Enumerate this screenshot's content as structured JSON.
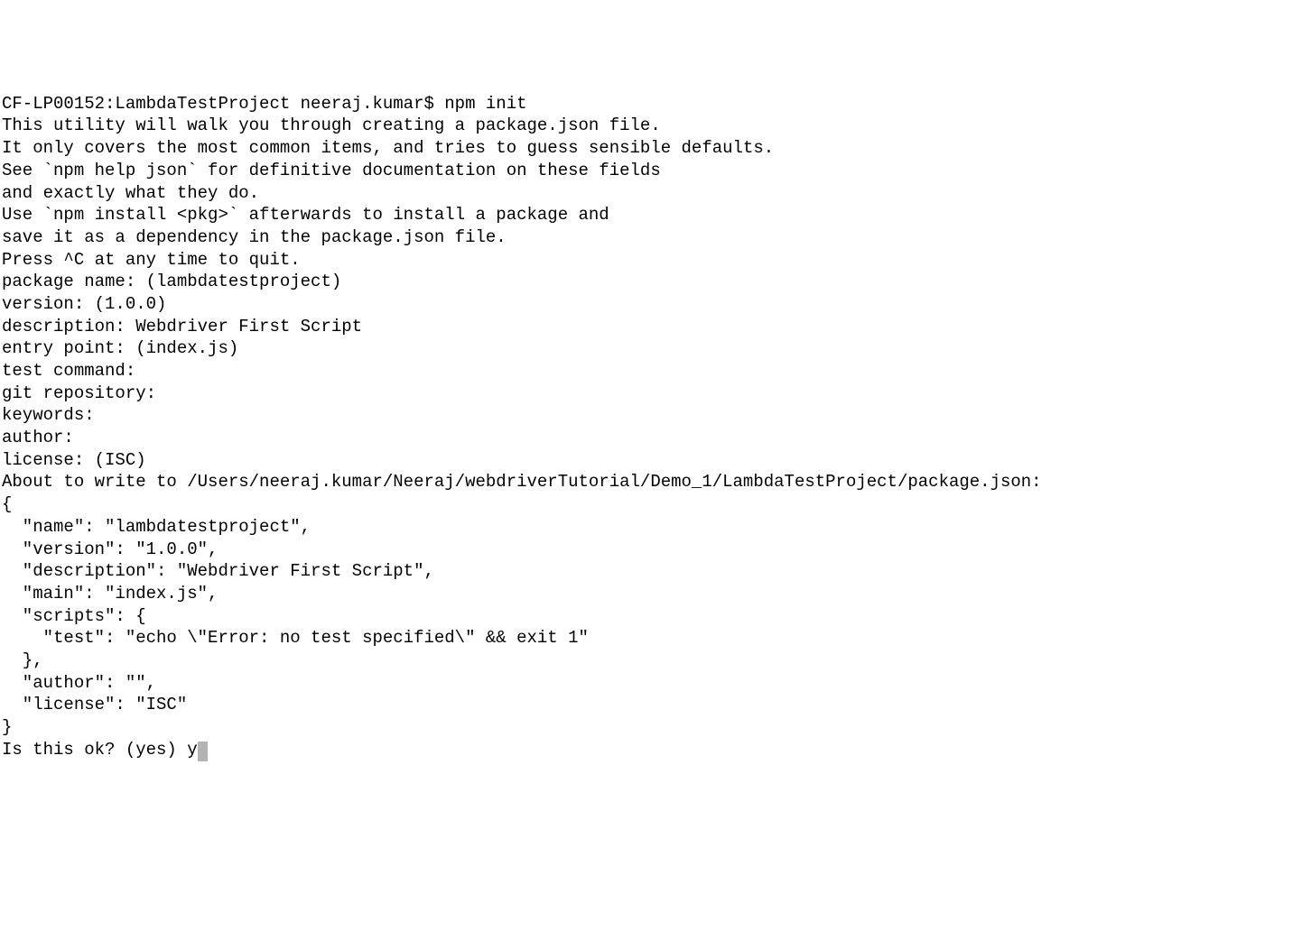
{
  "terminal": {
    "prompt_line": "CF-LP00152:LambdaTestProject neeraj.kumar$ npm init",
    "intro_1": "This utility will walk you through creating a package.json file.",
    "intro_2": "It only covers the most common items, and tries to guess sensible defaults.",
    "blank_1": "",
    "see_1": "See `npm help json` for definitive documentation on these fields",
    "see_2": "and exactly what they do.",
    "blank_2": "",
    "use_1": "Use `npm install <pkg>` afterwards to install a package and",
    "use_2": "save it as a dependency in the package.json file.",
    "blank_3": "",
    "press": "Press ^C at any time to quit.",
    "pkg_name": "package name: (lambdatestproject) ",
    "version": "version: (1.0.0) ",
    "description": "description: Webdriver First Script",
    "entry": "entry point: (index.js) ",
    "test_cmd": "test command: ",
    "git_repo": "git repository: ",
    "keywords": "keywords: ",
    "author": "author: ",
    "license": "license: (ISC) ",
    "about": "About to write to /Users/neeraj.kumar/Neeraj/webdriverTutorial/Demo_1/LambdaTestProject/package.json:",
    "blank_4": "",
    "json_1": "{",
    "json_2": "  \"name\": \"lambdatestproject\",",
    "json_3": "  \"version\": \"1.0.0\",",
    "json_4": "  \"description\": \"Webdriver First Script\",",
    "json_5": "  \"main\": \"index.js\",",
    "json_6": "  \"scripts\": {",
    "json_7": "    \"test\": \"echo \\\"Error: no test specified\\\" && exit 1\"",
    "json_8": "  },",
    "json_9": "  \"author\": \"\",",
    "json_10": "  \"license\": \"ISC\"",
    "json_11": "}",
    "blank_5": "",
    "blank_6": "",
    "is_ok": "Is this ok? (yes) y"
  }
}
